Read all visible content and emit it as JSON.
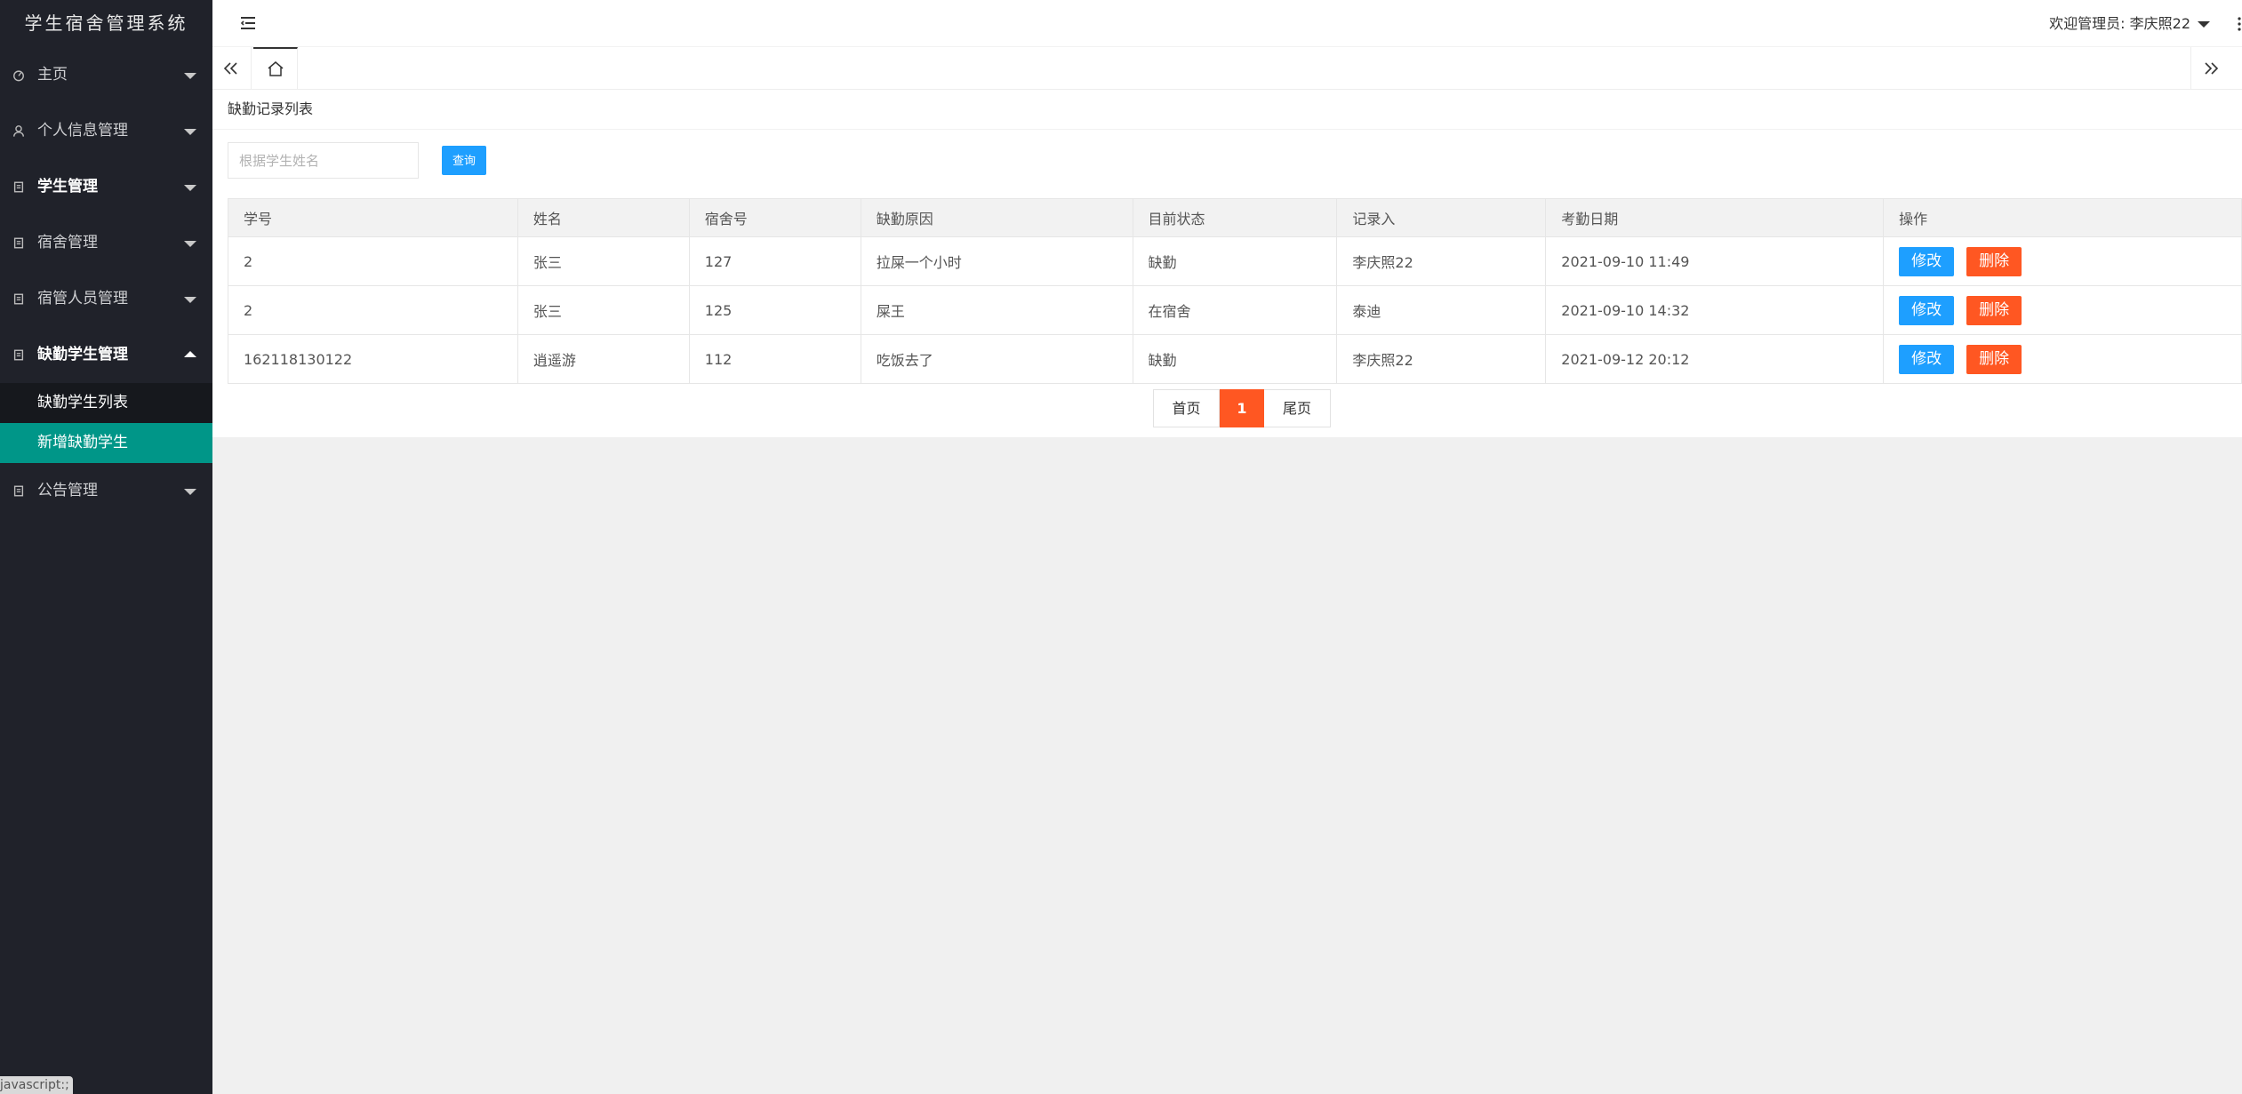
{
  "app": {
    "title": "学生宿舍管理系统"
  },
  "sidebar": {
    "items": [
      {
        "label": "主页",
        "icon": "dashboard-icon"
      },
      {
        "label": "个人信息管理",
        "icon": "user-icon"
      },
      {
        "label": "学生管理",
        "icon": "file-icon"
      },
      {
        "label": "宿舍管理",
        "icon": "file-icon"
      },
      {
        "label": "宿管人员管理",
        "icon": "file-icon"
      },
      {
        "label": "缺勤学生管理",
        "icon": "file-icon"
      },
      {
        "label": "公告管理",
        "icon": "file-icon"
      }
    ],
    "sub_items": [
      {
        "label": "缺勤学生列表"
      },
      {
        "label": "新增缺勤学生"
      }
    ],
    "status_tip": "javascript:;"
  },
  "header": {
    "welcome": "欢迎管理员: 李庆照22"
  },
  "page": {
    "title": "缺勤记录列表",
    "search_placeholder": "根据学生姓名",
    "search_button": "查询"
  },
  "table": {
    "columns": [
      "学号",
      "姓名",
      "宿舍号",
      "缺勤原因",
      "目前状态",
      "记录入",
      "考勤日期",
      "操作"
    ],
    "rows": [
      {
        "id": "2",
        "name": "张三",
        "room": "127",
        "reason": "拉屎一个小时",
        "status": "缺勤",
        "recorder": "李庆照22",
        "date": "2021-09-10 11:49"
      },
      {
        "id": "2",
        "name": "张三",
        "room": "125",
        "reason": "屎王",
        "status": "在宿舍",
        "recorder": "泰迪",
        "date": "2021-09-10 14:32"
      },
      {
        "id": "162118130122",
        "name": "逍遥游",
        "room": "112",
        "reason": "吃饭去了",
        "status": "缺勤",
        "recorder": "李庆照22",
        "date": "2021-09-12 20:12"
      }
    ],
    "edit_label": "修改",
    "delete_label": "删除"
  },
  "pager": {
    "first": "首页",
    "current": "1",
    "last": "尾页"
  },
  "colors": {
    "sidebar_bg": "#20222a",
    "active_green": "#009688",
    "primary_blue": "#1e9fff",
    "danger_orange": "#ff5722"
  }
}
